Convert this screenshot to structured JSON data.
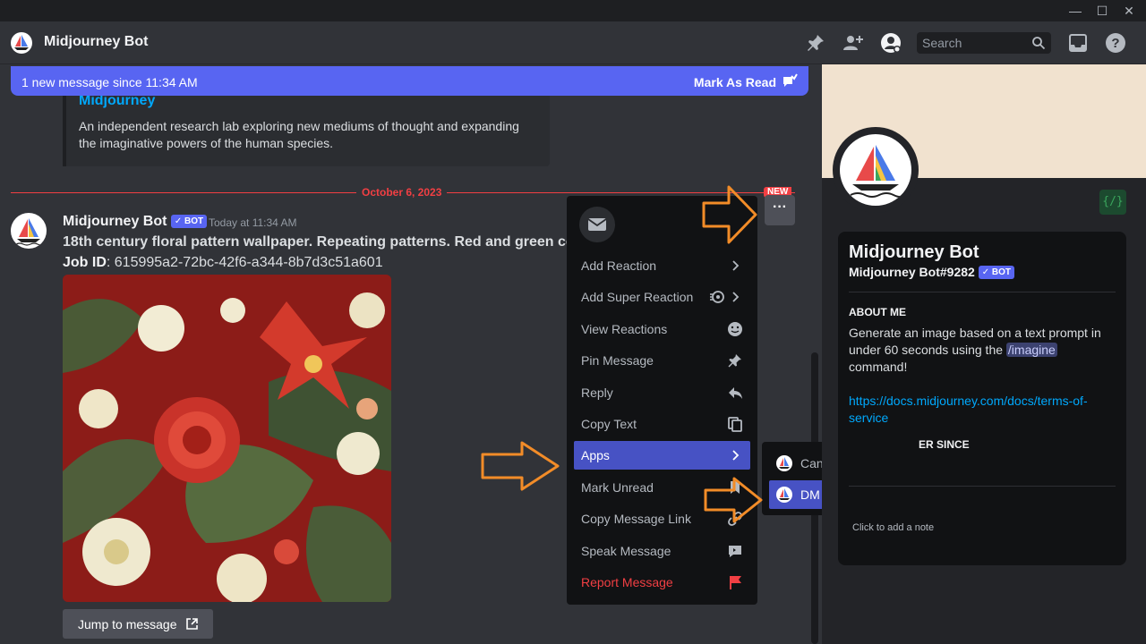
{
  "window": {
    "controls": {
      "minimize": "—",
      "maximize": "☐",
      "close": "✕"
    }
  },
  "header": {
    "title": "Midjourney Bot",
    "search_placeholder": "Search",
    "icons": [
      "pin-icon",
      "add-friend-icon",
      "profile-icon",
      "inbox-icon",
      "help-icon"
    ]
  },
  "new_messages_bar": {
    "text": "1 new message since 11:34 AM",
    "action": "Mark As Read"
  },
  "embed": {
    "title": "Midjourney",
    "description": "An independent research lab exploring new mediums of thought and expanding the imaginative powers of the human species."
  },
  "divider": {
    "date": "October 6, 2023",
    "badge": "NEW"
  },
  "message": {
    "author": "Midjourney Bot",
    "bot_tag": "✓ BOT",
    "timestamp": "Today at 11:34 AM",
    "prompt": "18th century floral pattern wallpaper. Repeating patterns. Red and green color scheme",
    "job_id_label": "Job ID",
    "job_id": ": 615995a2-72bc-42f6-a344-8b7d3c51a601",
    "jump_button": "Jump to message"
  },
  "more_button": "···",
  "context_menu": {
    "items": [
      {
        "label": "Add Reaction",
        "icon": "chevron-right-icon"
      },
      {
        "label": "Add Super Reaction",
        "icon": "super-reaction-icon"
      },
      {
        "label": "View Reactions",
        "icon": "smiley-icon"
      },
      {
        "label": "Pin Message",
        "icon": "pin-icon"
      },
      {
        "label": "Reply",
        "icon": "reply-icon"
      },
      {
        "label": "Copy Text",
        "icon": "copy-icon"
      },
      {
        "label": "Apps",
        "icon": "chevron-right-icon"
      },
      {
        "label": "Mark Unread",
        "icon": "unread-icon"
      },
      {
        "label": "Copy Message Link",
        "icon": "link-icon"
      },
      {
        "label": "Speak Message",
        "icon": "speak-icon"
      },
      {
        "label": "Report Message",
        "icon": "flag-icon"
      }
    ]
  },
  "apps_submenu": {
    "items": [
      {
        "label": "Cancel Job"
      },
      {
        "label": "DM Results"
      }
    ]
  },
  "profile": {
    "name": "Midjourney Bot",
    "tag": "Midjourney Bot#9282",
    "bot_tag": "✓ BOT",
    "about_heading": "ABOUT ME",
    "about_before": "Generate an image based on a text prompt in under 60 seconds using the ",
    "about_command": "/imagine",
    "about_after": " command!",
    "link": "https://docs.midjourney.com/docs/terms-of-service",
    "member_since_heading": "ER SINCE",
    "note_placeholder": "Click to add a note"
  },
  "colors": {
    "accent": "#5865f2",
    "danger": "#f23f43",
    "link": "#00a8fc",
    "arrow": "#f28c28"
  }
}
